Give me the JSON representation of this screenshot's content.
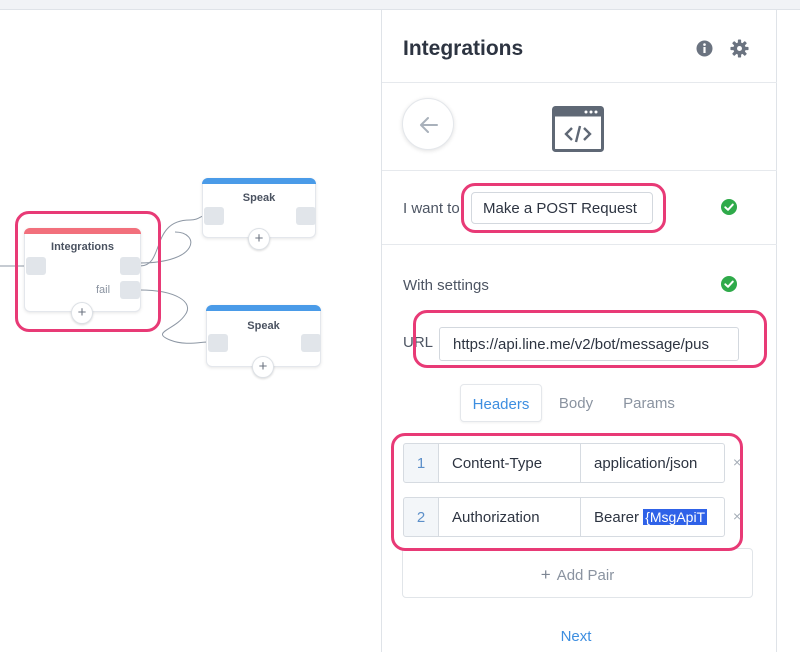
{
  "canvas": {
    "integrations_node": {
      "title": "Integrations",
      "fail_label": "fail",
      "add_symbol": "+"
    },
    "speak_node_top": {
      "title": "Speak",
      "add_symbol": "+"
    },
    "speak_node_bottom": {
      "title": "Speak",
      "add_symbol": "+"
    }
  },
  "panel": {
    "title": "Integrations",
    "icons": {
      "info": "info-icon",
      "settings": "gear-icon",
      "back": "arrow-left-icon",
      "integration_type": "code-window-icon",
      "valid": "check-circle-icon"
    },
    "action": {
      "label": "I want to",
      "value": "Make a POST Request"
    },
    "settings": {
      "label": "With settings"
    },
    "url": {
      "label": "URL",
      "value": "https://api.line.me/v2/bot/message/pus"
    },
    "tabs": [
      {
        "label": "Headers",
        "active": true
      },
      {
        "label": "Body",
        "active": false
      },
      {
        "label": "Params",
        "active": false
      }
    ],
    "headers": [
      {
        "index": "1",
        "key": "Content-Type",
        "value": "application/json",
        "remove": "×"
      },
      {
        "index": "2",
        "key": "Authorization",
        "value_prefix": "Bearer ",
        "value_variable": "{MsgApiT",
        "remove": "×"
      }
    ],
    "add_pair": {
      "symbol": "+",
      "label": "Add Pair"
    },
    "next_label": "Next"
  },
  "colors": {
    "highlight": "#e83a76",
    "accent_blue": "#3d8ee0",
    "success_green": "#2faa4a",
    "node_blue": "#4a9be8",
    "node_red": "#f2707c"
  }
}
